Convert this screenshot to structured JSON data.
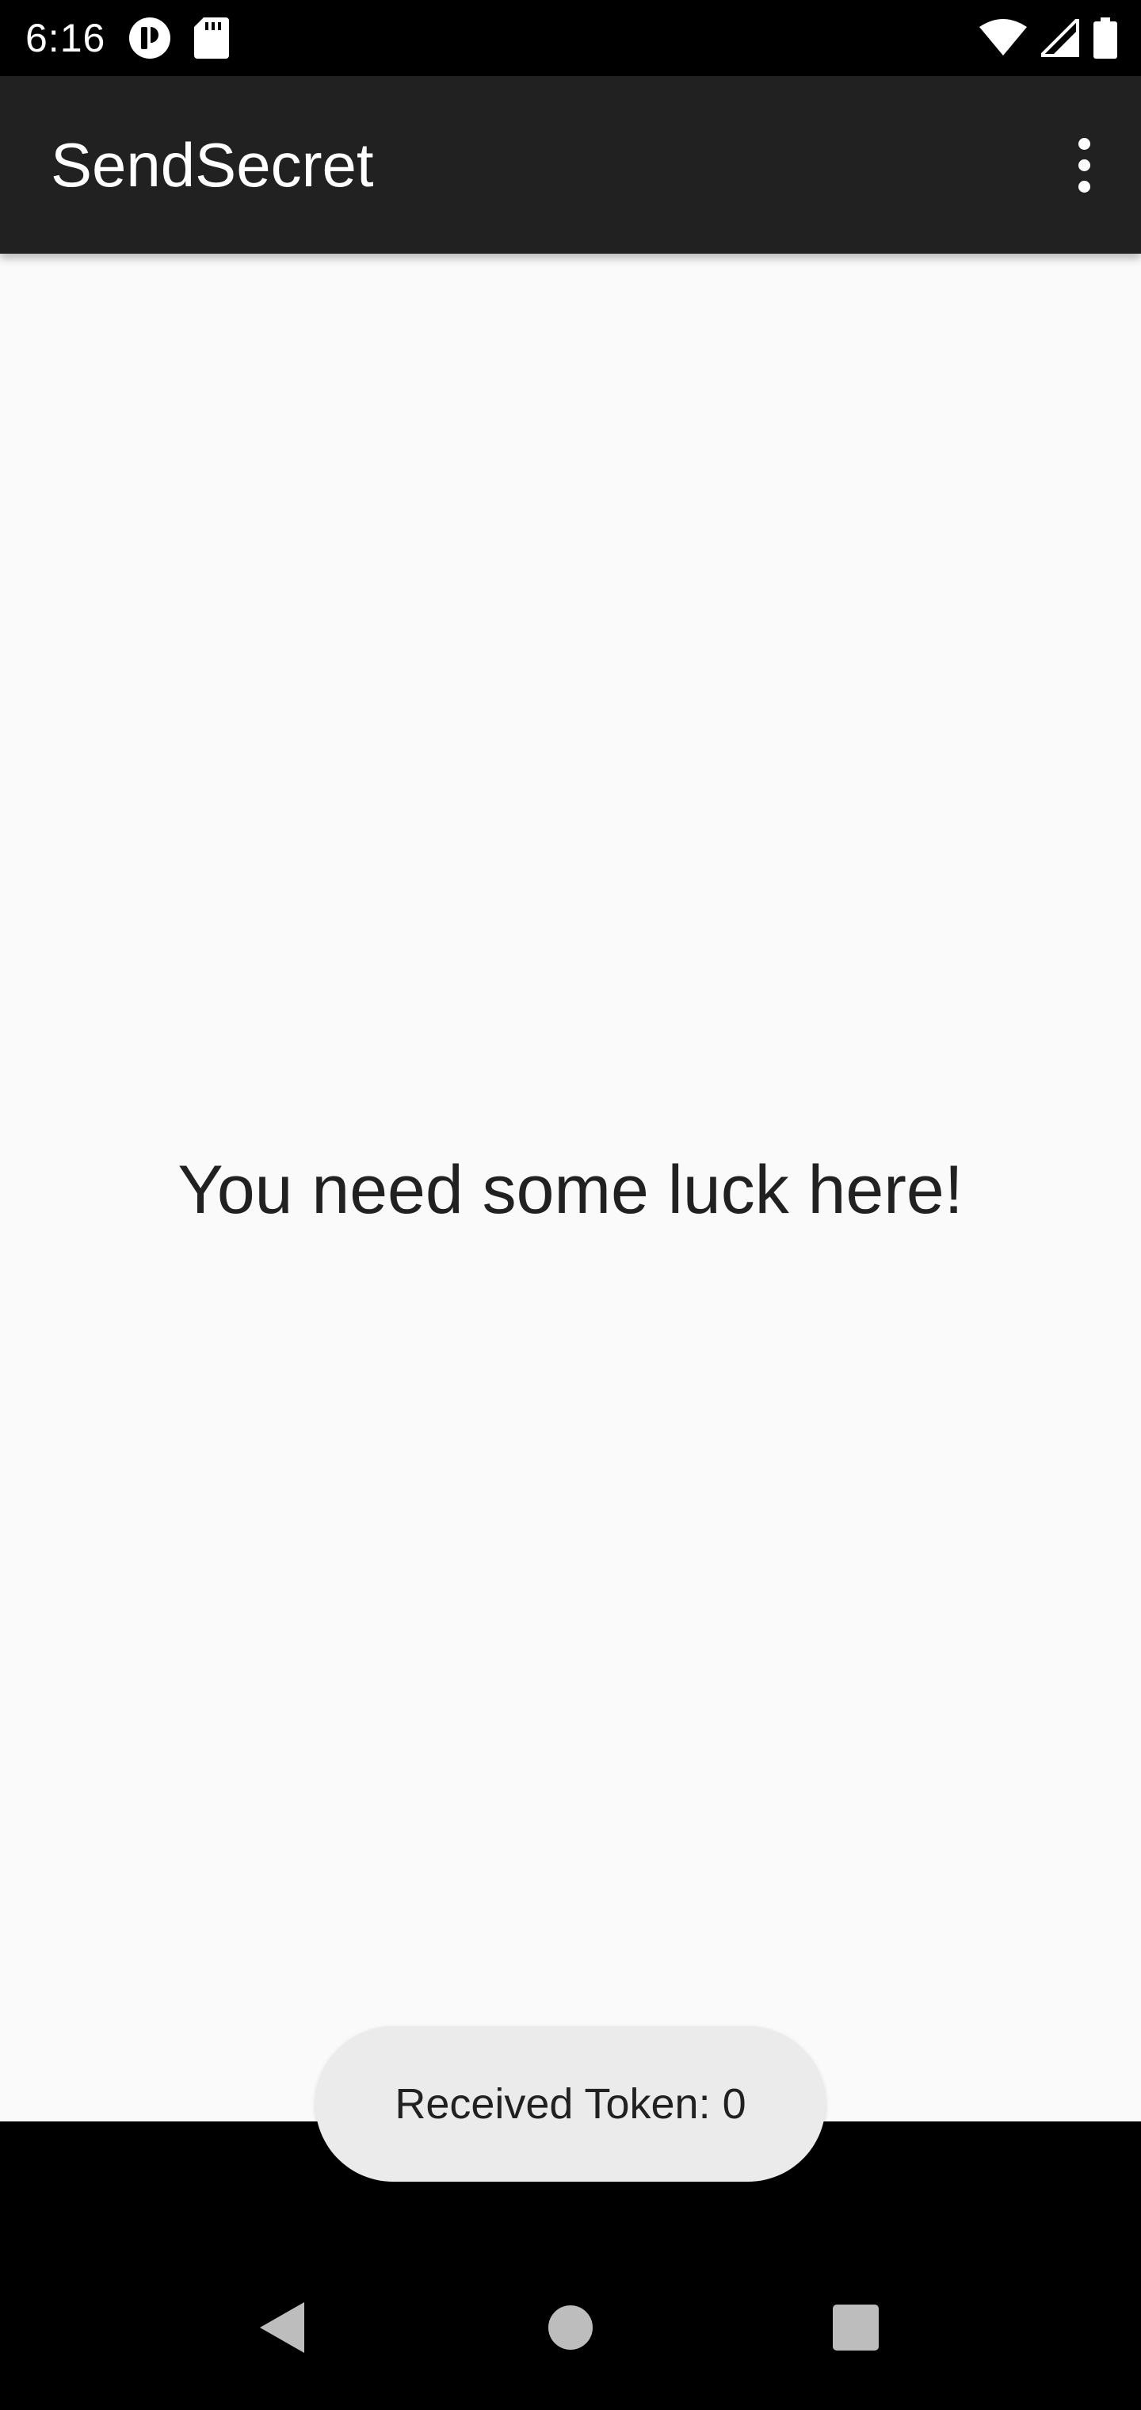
{
  "status_bar": {
    "time": "6:16",
    "left_icons": [
      "media-indicator-icon",
      "sd-card-icon"
    ],
    "right_icons": [
      "wifi-icon",
      "cellular-signal-icon",
      "battery-icon"
    ]
  },
  "app_bar": {
    "title": "SendSecret",
    "overflow_icon": "more-vert-icon"
  },
  "main": {
    "message": "You need some luck here!"
  },
  "toast": {
    "text": "Received Token: 0"
  },
  "nav_bar": {
    "icons": [
      "back-icon",
      "home-icon",
      "recents-icon"
    ]
  },
  "colors": {
    "status_bar": "#000000",
    "app_bar": "#212121",
    "background": "#fafafa",
    "toast": "#ebebeb",
    "nav_bar": "#000000"
  }
}
